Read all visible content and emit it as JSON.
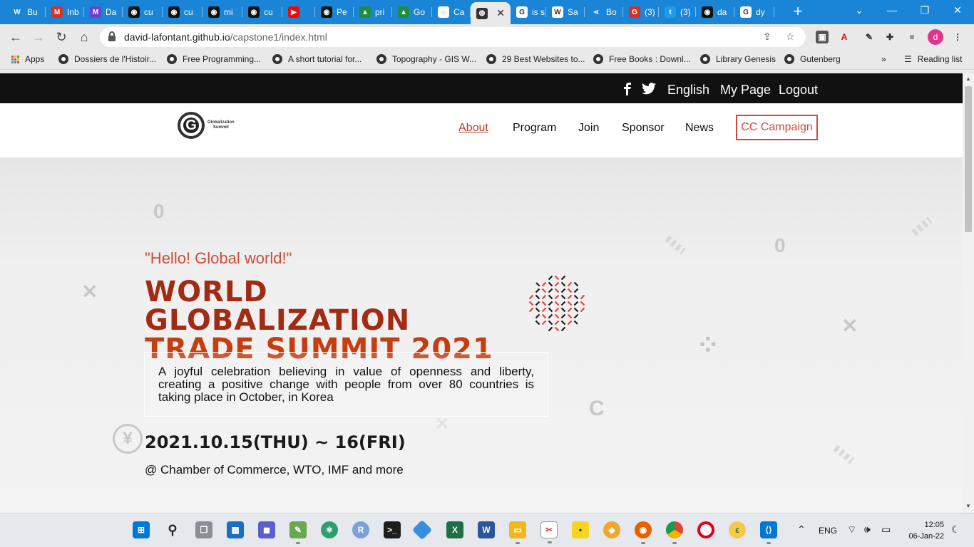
{
  "browser": {
    "tabs": [
      {
        "label": "Bu",
        "icon": "webflow-icon",
        "color": "#1a84d6",
        "glyph": "W"
      },
      {
        "label": "Inb",
        "icon": "gmail-icon",
        "color": "#d93025",
        "glyph": "M"
      },
      {
        "label": "Da",
        "icon": "make-icon",
        "color": "#6d3fd6",
        "glyph": "M"
      },
      {
        "label": "cu",
        "icon": "github-icon",
        "color": "#111111",
        "glyph": "◉"
      },
      {
        "label": "cu",
        "icon": "github-icon",
        "color": "#111111",
        "glyph": "◉"
      },
      {
        "label": "mi",
        "icon": "github-icon",
        "color": "#111111",
        "glyph": "◉"
      },
      {
        "label": "cu",
        "icon": "github-icon",
        "color": "#111111",
        "glyph": "◉"
      },
      {
        "label": "",
        "icon": "youtube-icon",
        "color": "#ff0000",
        "glyph": "▶"
      },
      {
        "label": "Pe",
        "icon": "github-icon",
        "color": "#111111",
        "glyph": "◉"
      },
      {
        "label": "pri",
        "icon": "drive-icon",
        "color": "#1e8e3e",
        "glyph": "▲"
      },
      {
        "label": "Go",
        "icon": "drive-icon",
        "color": "#1e8e3e",
        "glyph": "▲"
      },
      {
        "label": "Ca",
        "icon": "loading-icon",
        "color": "#ffffff",
        "glyph": "◌"
      },
      {
        "label": "",
        "icon": "globe-icon",
        "color": "#333333",
        "glyph": "◍",
        "active": true
      },
      {
        "label": "is s",
        "icon": "google-icon",
        "color": "#ffffff",
        "glyph": "G"
      },
      {
        "label": "Sa",
        "icon": "wikipedia-icon",
        "color": "#ffffff",
        "glyph": "W"
      },
      {
        "label": "Bo",
        "icon": "share-icon",
        "color": "#1a84d6",
        "glyph": "⋖"
      },
      {
        "label": "(3)",
        "icon": "google-c-icon",
        "color": "#d93025",
        "glyph": "G"
      },
      {
        "label": "(3)",
        "icon": "twitter-icon",
        "color": "#1d9bf0",
        "glyph": "t"
      },
      {
        "label": "da",
        "icon": "github-icon",
        "color": "#111111",
        "glyph": "◉"
      },
      {
        "label": "dy",
        "icon": "google-icon",
        "color": "#ffffff",
        "glyph": "G"
      }
    ],
    "address": {
      "host": "david-lafontant.github.io",
      "path": "/capstone1/index.html"
    },
    "bookmarks": [
      {
        "label": "Apps"
      },
      {
        "label": "Dossiers de l'Histoir..."
      },
      {
        "label": "Free Programming..."
      },
      {
        "label": "A short tutorial for..."
      },
      {
        "label": "Topography - GIS W..."
      },
      {
        "label": "29 Best Websites to..."
      },
      {
        "label": "Free Books : Downl..."
      },
      {
        "label": "Library Genesis"
      },
      {
        "label": "Gutenberg"
      }
    ],
    "overflow": "»",
    "reading_list": "Reading list",
    "profile_initial": "d"
  },
  "site": {
    "topbar": {
      "language": "English",
      "my_page": "My Page",
      "logout": "Logout"
    },
    "logo": {
      "letter": "G",
      "line1": "Globalization",
      "line2": "Summit"
    },
    "nav": {
      "about": "About",
      "program": "Program",
      "join": "Join",
      "sponsor": "Sponsor",
      "news": "News",
      "campaign": "CC Campaign"
    },
    "hero": {
      "greeting": "\"Hello! Global world!\"",
      "headline_line1": "WORLD GLOBALIZATION",
      "headline_line2": "TRADE SUMMIT 2021",
      "description": "A joyful celebration believing in value of openness and liberty, creating a positive change with people from over 80 countries is taking place in October, in Korea",
      "date": "2021.10.15(THU) ~ 16(FRI)",
      "venue": "@ Chamber of Commerce, WTO, IMF and more"
    },
    "colors": {
      "accent": "#d24a3b",
      "headline_dark": "#a22b14",
      "headline_light": "#c63d12",
      "topbar": "#111111"
    }
  },
  "taskbar": {
    "lang": "ENG",
    "time": "12:05",
    "date": "06-Jan-22"
  }
}
